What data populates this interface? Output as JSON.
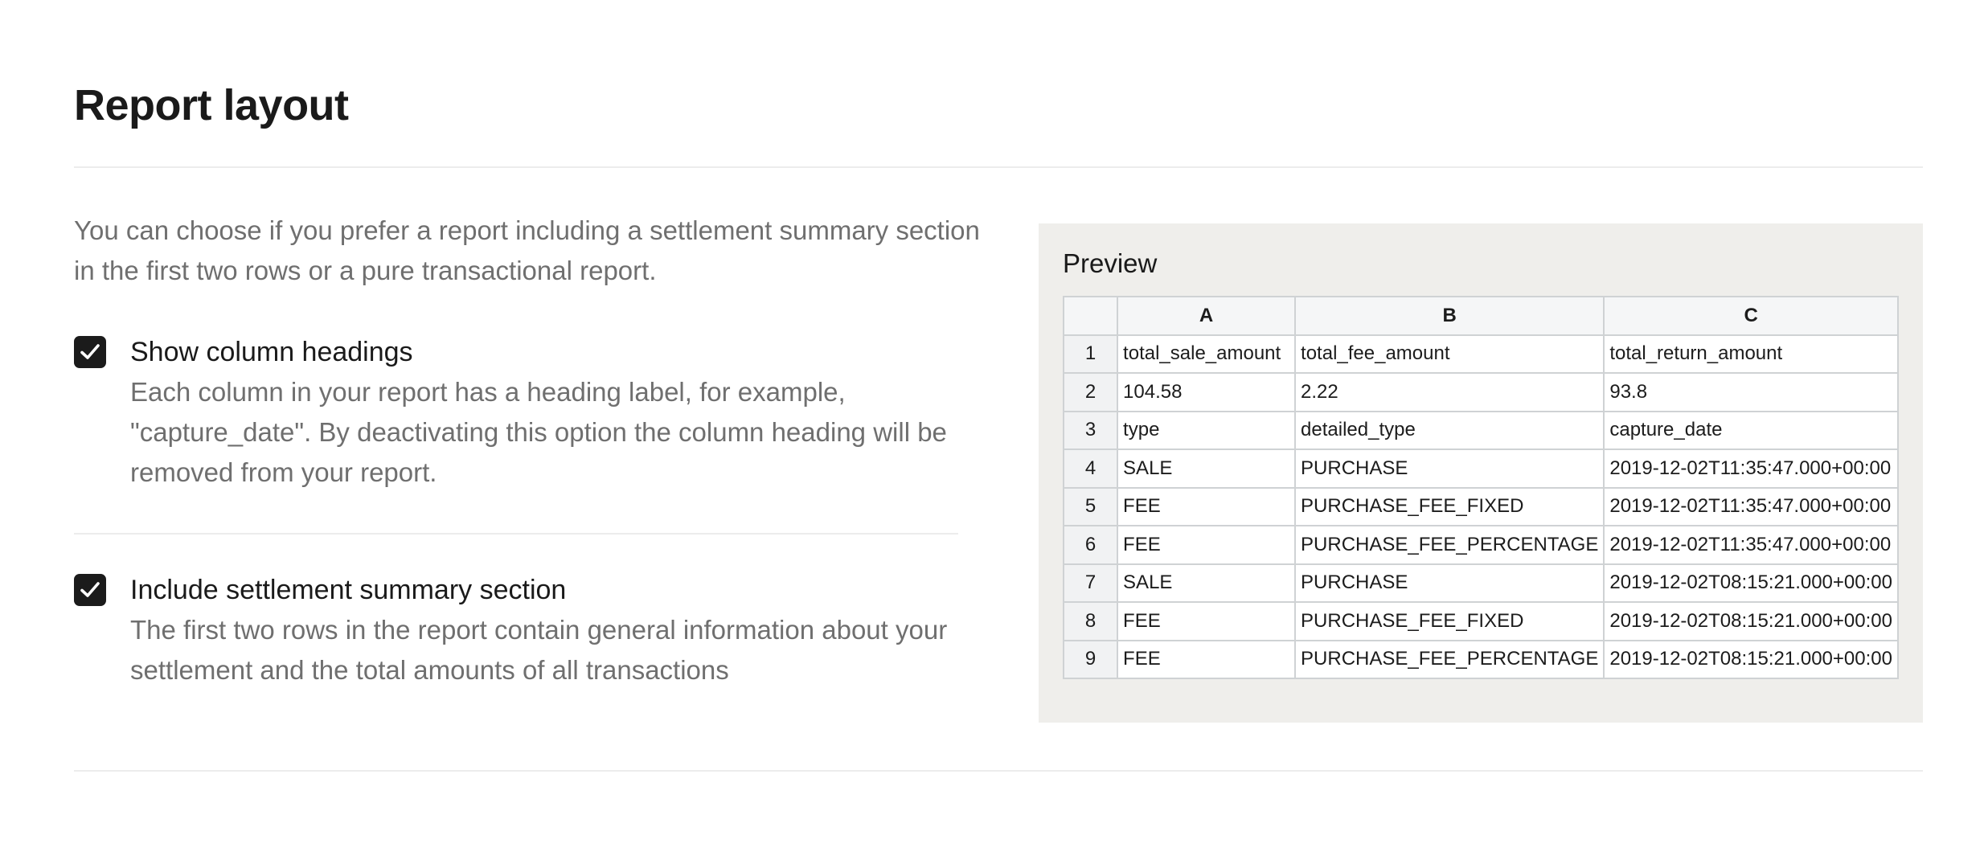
{
  "page": {
    "title": "Report layout",
    "intro": "You can choose if you prefer a report including a settlement summary section in the first two rows or a pure transactional report."
  },
  "options": [
    {
      "title": "Show column headings",
      "description": "Each column in your report has a heading label, for example, \"capture_date\". By deactivating this option the column heading will be removed from your report.",
      "checked": true
    },
    {
      "title": "Include settlement summary section",
      "description": "The first two rows in the report contain general information about your settlement and the total amounts of all transactions",
      "checked": true
    }
  ],
  "preview": {
    "title": "Preview",
    "columns": [
      "",
      "A",
      "B",
      "C"
    ],
    "rows": [
      {
        "num": "1",
        "cells": [
          "total_sale_amount",
          "total_fee_amount",
          "total_return_amount"
        ]
      },
      {
        "num": "2",
        "cells": [
          "104.58",
          "2.22",
          "93.8"
        ]
      },
      {
        "num": "3",
        "cells": [
          "type",
          "detailed_type",
          "capture_date"
        ]
      },
      {
        "num": "4",
        "cells": [
          "SALE",
          "PURCHASE",
          "2019-12-02T11:35:47.000+00:00"
        ]
      },
      {
        "num": "5",
        "cells": [
          "FEE",
          "PURCHASE_FEE_FIXED",
          "2019-12-02T11:35:47.000+00:00"
        ]
      },
      {
        "num": "6",
        "cells": [
          "FEE",
          "PURCHASE_FEE_PERCENTAGE",
          "2019-12-02T11:35:47.000+00:00"
        ]
      },
      {
        "num": "7",
        "cells": [
          "SALE",
          "PURCHASE",
          "2019-12-02T08:15:21.000+00:00"
        ]
      },
      {
        "num": "8",
        "cells": [
          "FEE",
          "PURCHASE_FEE_FIXED",
          "2019-12-02T08:15:21.000+00:00"
        ]
      },
      {
        "num": "9",
        "cells": [
          "FEE",
          "PURCHASE_FEE_PERCENTAGE",
          "2019-12-02T08:15:21.000+00:00"
        ]
      }
    ]
  },
  "colors": {
    "checkbox": "#1b1b1b",
    "preview_bg": "#efeeeb",
    "muted_text": "#6f6f6f"
  }
}
